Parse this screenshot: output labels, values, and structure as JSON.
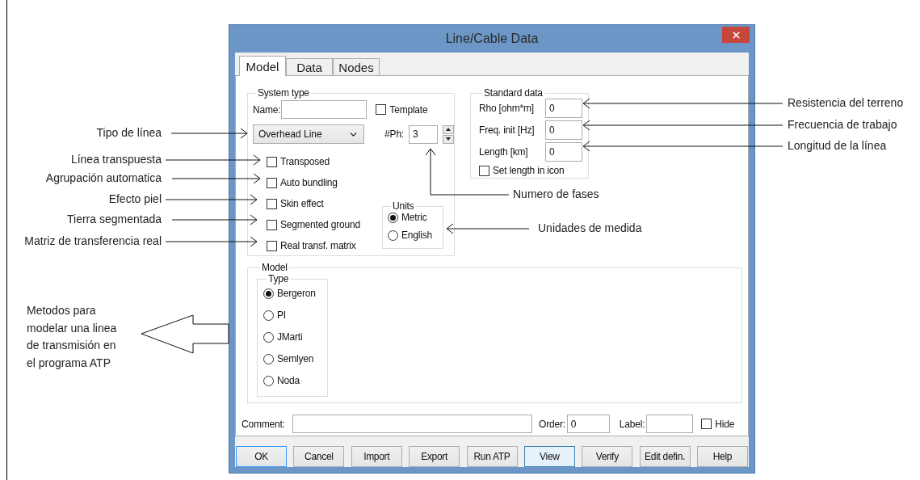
{
  "window": {
    "title": "Line/Cable Data"
  },
  "tabs": [
    {
      "label": "Model",
      "selected": true
    },
    {
      "label": "Data",
      "selected": false
    },
    {
      "label": "Nodes",
      "selected": false
    }
  ],
  "system_type": {
    "title": "System type",
    "name_label": "Name:",
    "template": {
      "label": "Template",
      "checked": false
    },
    "line_type": "Overhead Line",
    "phases_label": "#Ph:",
    "phases_value": "3",
    "options": [
      {
        "label": "Transposed",
        "checked": false
      },
      {
        "label": "Auto bundling",
        "checked": false
      },
      {
        "label": "Skin effect",
        "checked": false
      },
      {
        "label": "Segmented ground",
        "checked": false
      },
      {
        "label": "Real transf. matrix",
        "checked": false
      }
    ],
    "units": {
      "title": "Units",
      "options": [
        {
          "label": "Metric",
          "selected": true
        },
        {
          "label": "English",
          "selected": false
        }
      ]
    }
  },
  "standard_data": {
    "title": "Standard data",
    "fields": [
      {
        "label": "Rho [ohm*m]",
        "value": "0"
      },
      {
        "label": "Freq. init [Hz]",
        "value": "0"
      },
      {
        "label": "Length [km]",
        "value": "0"
      }
    ],
    "set_length": {
      "label": "Set length in icon",
      "checked": false
    }
  },
  "model": {
    "title": "Model",
    "type_title": "Type",
    "types": [
      {
        "label": "Bergeron",
        "selected": true
      },
      {
        "label": "PI",
        "selected": false
      },
      {
        "label": "JMarti",
        "selected": false
      },
      {
        "label": "Semlyen",
        "selected": false
      },
      {
        "label": "Noda",
        "selected": false
      }
    ]
  },
  "footer": {
    "comment_label": "Comment:",
    "order_label": "Order:",
    "order_value": "0",
    "label_label": "Label:",
    "hide": {
      "label": "Hide",
      "checked": false
    }
  },
  "buttons": [
    {
      "label": "OK",
      "focused": true,
      "hovered": false
    },
    {
      "label": "Cancel",
      "focused": false,
      "hovered": false
    },
    {
      "label": "Import",
      "focused": false,
      "hovered": false
    },
    {
      "label": "Export",
      "focused": false,
      "hovered": false
    },
    {
      "label": "Run ATP",
      "focused": false,
      "hovered": false
    },
    {
      "label": "View",
      "focused": false,
      "hovered": true
    },
    {
      "label": "Verify",
      "focused": false,
      "hovered": false
    },
    {
      "label": "Edit defin.",
      "focused": false,
      "hovered": false
    },
    {
      "label": "Help",
      "focused": false,
      "hovered": false
    }
  ],
  "annotations": {
    "left": [
      "Tipo de línea",
      "Línea transpuesta",
      "Agrupación automatica",
      "Efecto piel",
      "Tierra segmentada",
      "Matriz de transferencia real"
    ],
    "methods_note": [
      "Metodos para",
      "modelar una linea",
      "de transmisión en",
      "el programa ATP"
    ],
    "right": [
      "Resistencia del terreno",
      "Frecuencia de trabajo",
      "Longitud de la línea"
    ],
    "phases_note": "Numero de fases",
    "units_note": "Unidades de medida"
  }
}
